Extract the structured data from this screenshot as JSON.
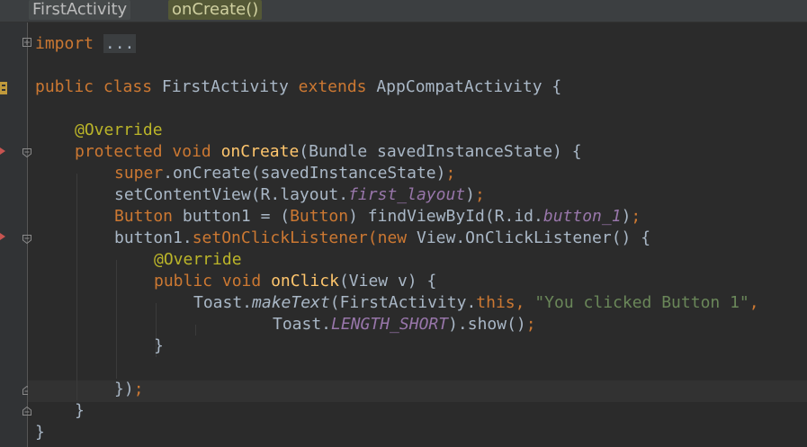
{
  "breadcrumb": {
    "class_name": "FirstActivity",
    "method_name": "onCreate()"
  },
  "code": {
    "l1_import": "import",
    "l1_folded": "...",
    "l2_public": "public",
    "l2_class": "class",
    "l2_name": "FirstActivity",
    "l2_extends": "extends",
    "l2_super": "AppCompatActivity",
    "l2_brace": "{",
    "l3_override": "@Override",
    "l4_protected": "protected",
    "l4_void": "void",
    "l4_method": "onCreate",
    "l4_params": "(Bundle savedInstanceState) {",
    "l5_super": "super",
    "l5_call": ".onCreate(savedInstanceState)",
    "l5_semi": ";",
    "l6_call": "setContentView(R.layout.",
    "l6_field": "first_layout",
    "l6_close": ")",
    "l6_semi": ";",
    "l7_type": "Button",
    "l7_mid": " button1 = (",
    "l7_cast": "Button",
    "l7_find": ") findViewById(R.id.",
    "l7_field": "button_1",
    "l7_close": ")",
    "l7_semi": ";",
    "l8_obj": "button1.",
    "l8_method": "setOnClickListener",
    "l8_open": "(",
    "l8_new": "new",
    "l8_rest": " View.OnClickListener() {",
    "l9_override": "@Override",
    "l10_public": "public",
    "l10_void": "void",
    "l10_method": "onClick",
    "l10_params": "(View v) {",
    "l11_toast": "Toast.",
    "l11_make": "makeText",
    "l11_args": "(FirstActivity.",
    "l11_this": "this",
    "l11_comma": ",",
    "l11_str": "\"You clicked Button 1\"",
    "l11_comma2": ",",
    "l12_toast": "Toast.",
    "l12_field": "LENGTH_SHORT",
    "l12_show": ").show()",
    "l12_semi": ";",
    "l13_brace": "}",
    "l15_close": "})",
    "l15_semi": ";",
    "l16_brace": "}",
    "l17_brace": "}"
  },
  "colors": {
    "background": "#2B2B2B",
    "keyword": "#CC7832",
    "annotation": "#BBB529",
    "method": "#FFC66D",
    "string": "#6A8759",
    "field": "#9876AA",
    "text": "#A9B7C6"
  },
  "icons": [
    "override-marker-icon",
    "fold-icon",
    "expand-icon"
  ]
}
